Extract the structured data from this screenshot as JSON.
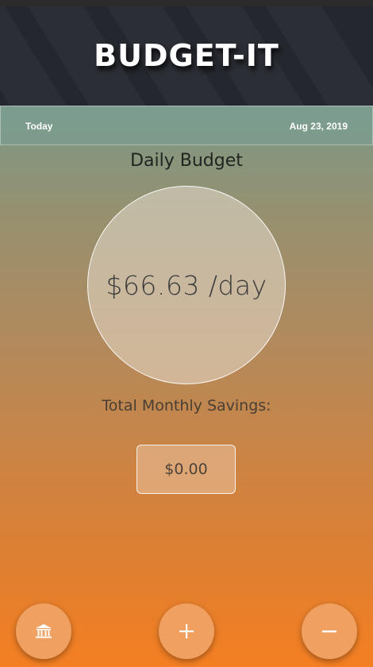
{
  "app": {
    "title": "BUDGET-IT"
  },
  "date_bar": {
    "label": "Today",
    "date": "Aug 23, 2019"
  },
  "budget": {
    "heading": "Daily Budget",
    "amount": "$66.63 /day"
  },
  "savings": {
    "label": "Total Monthly Savings:",
    "value": "$0.00"
  },
  "actions": [
    {
      "icon": "bank-icon"
    },
    {
      "icon": "plus-icon"
    },
    {
      "icon": "minus-icon"
    }
  ],
  "colors": {
    "header_bg": "#24272e",
    "gradient_top": "#7a9a8a",
    "gradient_bottom": "#f57f22",
    "fab_bg": "#f0a060"
  }
}
